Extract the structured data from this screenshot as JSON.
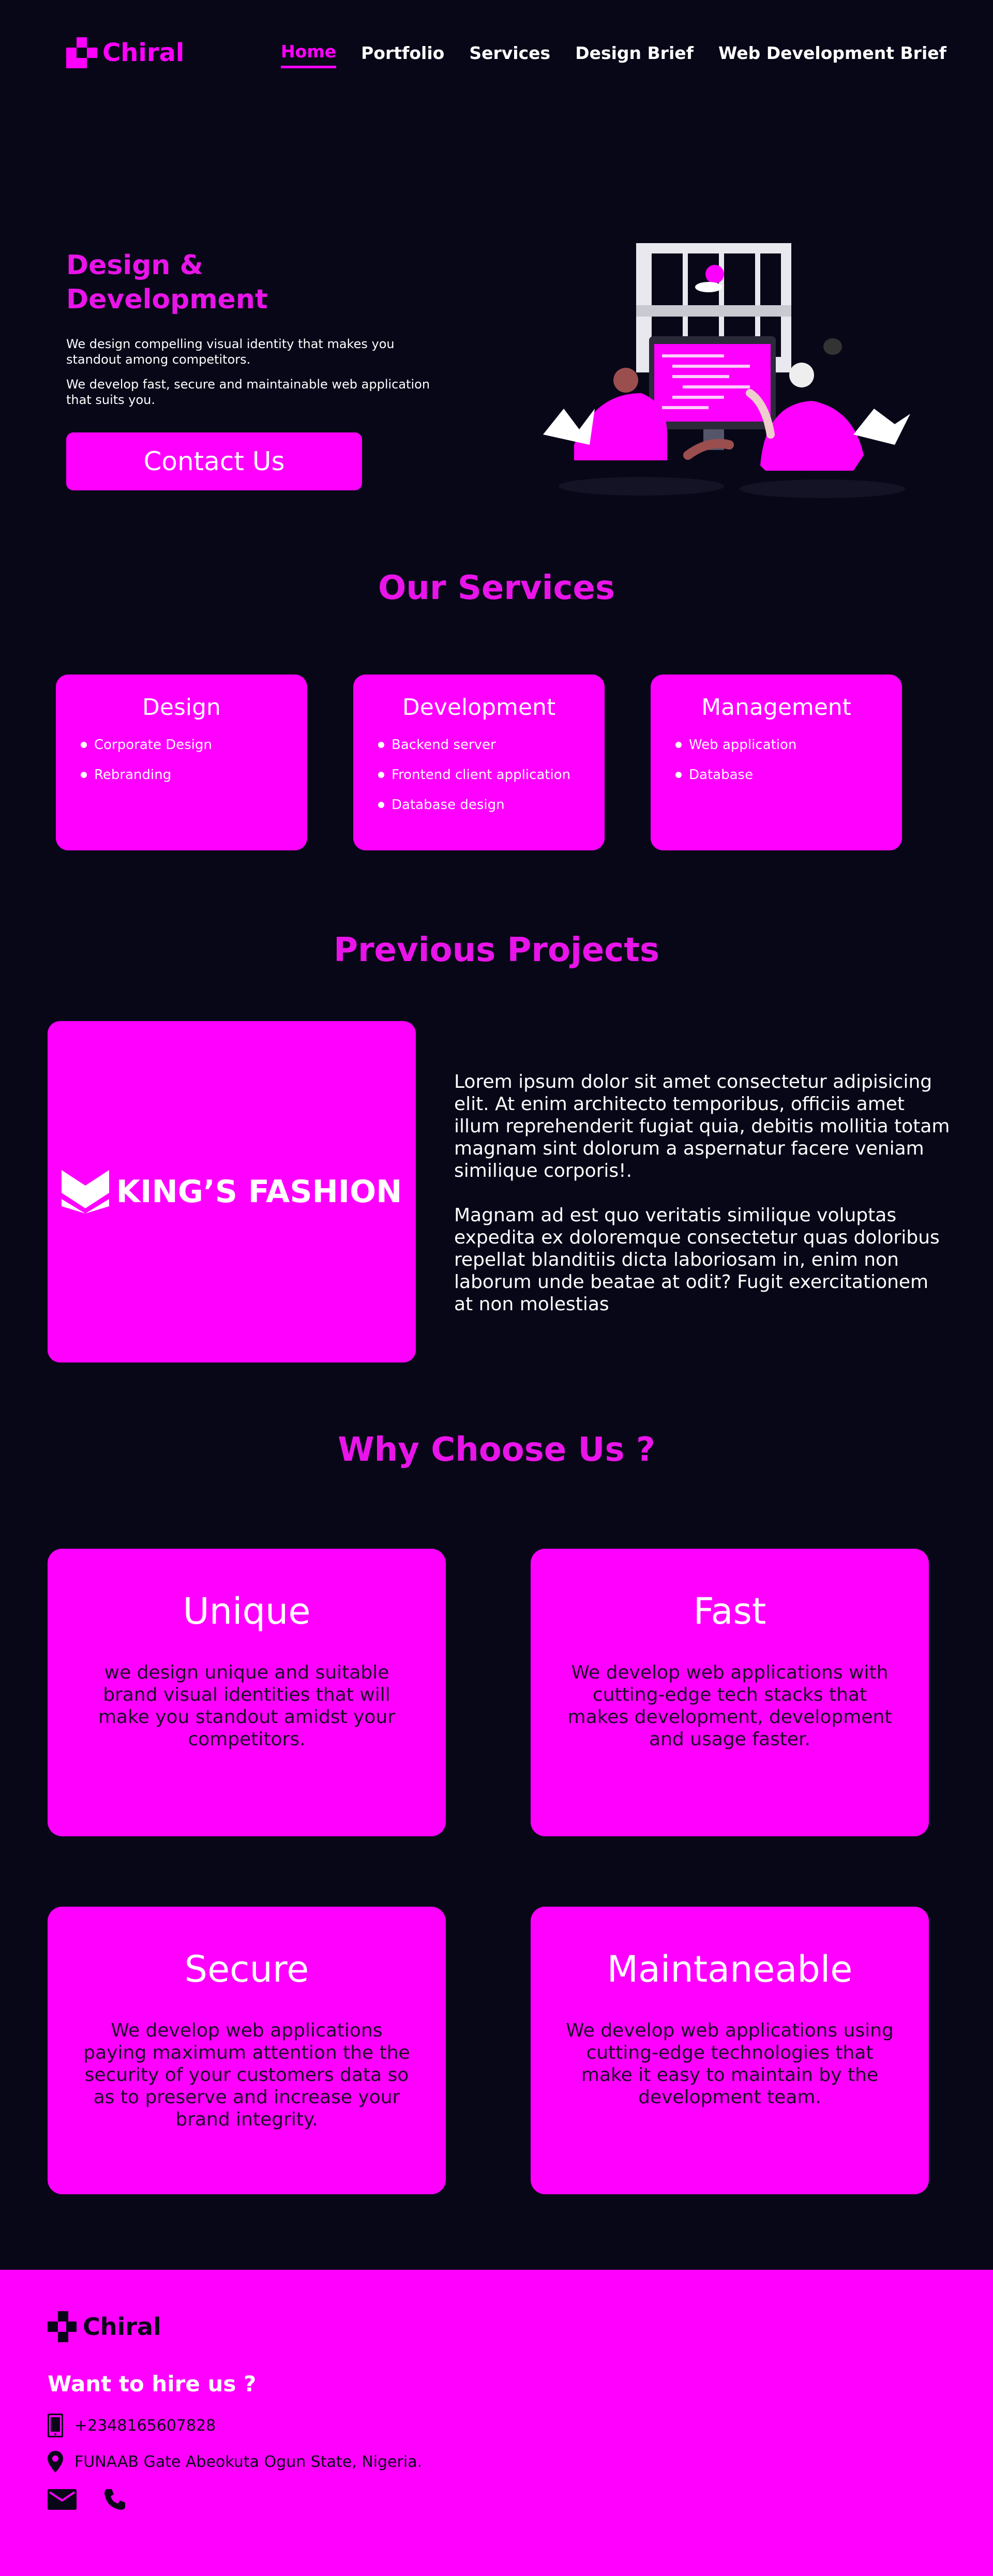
{
  "brand": {
    "name": "Chiral"
  },
  "nav": {
    "items": [
      {
        "label": "Home",
        "active": true
      },
      {
        "label": "Portfolio",
        "active": false
      },
      {
        "label": "Services",
        "active": false
      },
      {
        "label": "Design Brief",
        "active": false
      },
      {
        "label": "Web Development Brief",
        "active": false
      }
    ]
  },
  "hero": {
    "title": "Design & Development",
    "paragraph1": "We design compelling visual identity that makes you standout among competitors.",
    "paragraph2": "We develop fast, secure and maintainable web application that suits you.",
    "cta_label": "Contact Us"
  },
  "services": {
    "title": "Our Services",
    "cards": [
      {
        "title": "Design",
        "items": [
          "Corporate Design",
          "Rebranding"
        ]
      },
      {
        "title": "Development",
        "items": [
          "Backend server",
          "Frontend client application",
          "Database design"
        ]
      },
      {
        "title": "Management",
        "items": [
          "Web application",
          "Database"
        ]
      }
    ]
  },
  "projects": {
    "title": "Previous Projects",
    "project_name": "KING’S FASHION",
    "paragraph1": "Lorem ipsum dolor sit amet consectetur adipisicing elit. At enim architecto temporibus, officiis amet illum reprehenderit fugiat quia, debitis mollitia totam magnam sint dolorum a aspernatur facere veniam similique corporis!.",
    "paragraph2": "Magnam ad est quo veritatis similique voluptas expedita ex doloremque consectetur quas doloribus repellat blanditiis dicta laboriosam in, enim non laborum unde beatae at odit? Fugit exercitationem at non molestias"
  },
  "why": {
    "title": "Why Choose Us ?",
    "cards": [
      {
        "title": "Unique",
        "text": "we design unique and suitable brand visual identities that will make you standout amidst your competitors."
      },
      {
        "title": "Fast",
        "text": "We develop web applications with cutting-edge tech stacks that makes development, development and usage faster."
      },
      {
        "title": "Secure",
        "text": "We develop web applications paying maximum attention the the security of your customers data so as to preserve and increase your brand integrity."
      },
      {
        "title": "Maintaneable",
        "text": "We develop web applications using cutting-edge technologies that make it easy to maintain by the development team."
      }
    ]
  },
  "footer": {
    "brand": "Chiral",
    "hire_title": "Want to hire us ?",
    "phone": "+2348165607828",
    "address": "FUNAAB Gate Abeokuta Ogun State, Nigeria.",
    "icons": [
      "phone-icon",
      "location-icon",
      "mail-icon",
      "telephone-icon"
    ]
  },
  "colors": {
    "background": "#080718",
    "accent": "#ff00ff",
    "heading": "#e914e9"
  }
}
